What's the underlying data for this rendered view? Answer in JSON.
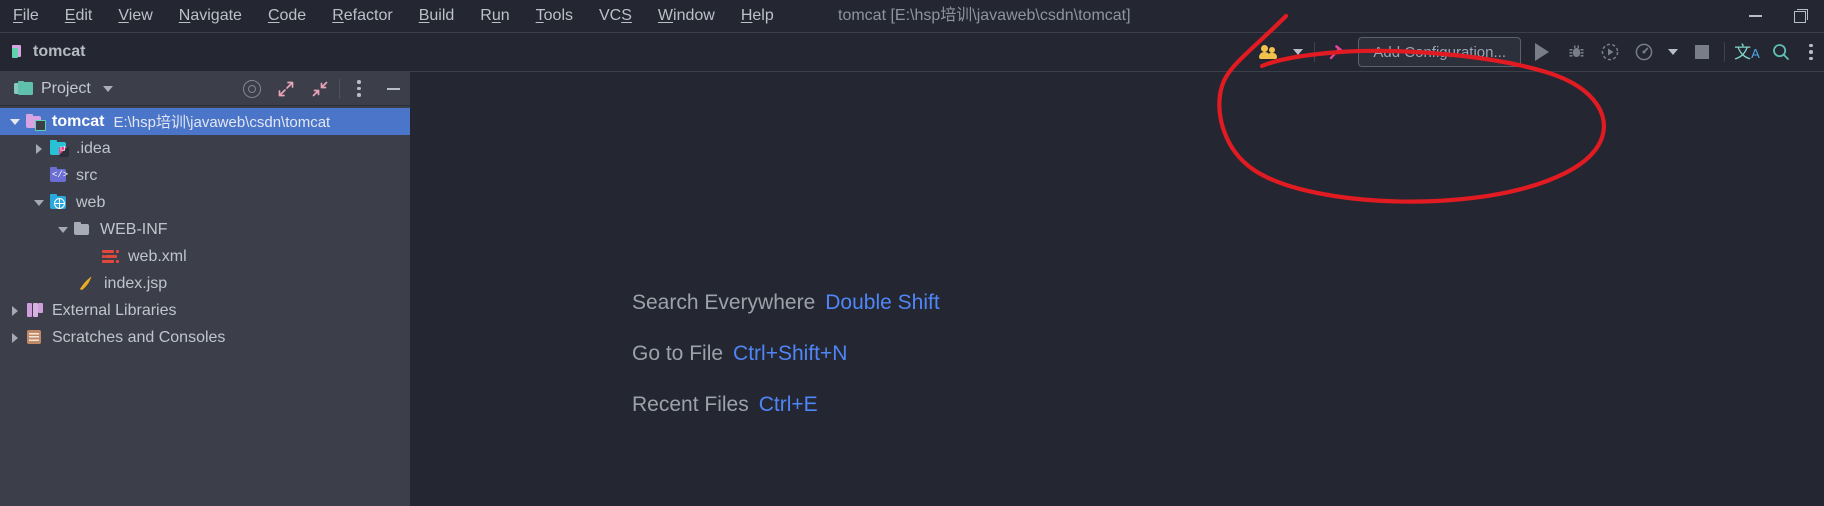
{
  "window": {
    "title": "tomcat [E:\\hsp培训\\javaweb\\csdn\\tomcat]",
    "minimize_label": "—",
    "restore_label": "❐",
    "colors": {
      "background": "#242731",
      "sidebar": "#3c3f4a",
      "selection": "#4b75c9",
      "accent_link": "#4f86f7",
      "annotation": "#e21b22"
    }
  },
  "menubar": {
    "items": [
      {
        "label": "File",
        "mnemonic": "F",
        "rest": "ile"
      },
      {
        "label": "Edit",
        "mnemonic": "E",
        "rest": "dit"
      },
      {
        "label": "View",
        "mnemonic": "V",
        "rest": "iew"
      },
      {
        "label": "Navigate",
        "mnemonic": "N",
        "rest": "avigate"
      },
      {
        "label": "Code",
        "mnemonic": "C",
        "rest": "ode"
      },
      {
        "label": "Refactor",
        "mnemonic": "R",
        "rest": "efactor"
      },
      {
        "label": "Build",
        "mnemonic": "B",
        "rest": "uild"
      },
      {
        "label": "Run",
        "mnemonic": "R",
        "rest": "un"
      },
      {
        "label": "Tools",
        "mnemonic": "T",
        "rest": "ools"
      },
      {
        "label": "VCS",
        "mnemonic": "S",
        "rest": "VC",
        "mnemonic_last": true
      },
      {
        "label": "Window",
        "mnemonic": "W",
        "rest": "indow"
      },
      {
        "label": "Help",
        "mnemonic": "H",
        "rest": "elp"
      }
    ]
  },
  "toolbar": {
    "breadcrumb": "tomcat",
    "breadcrumb_icon": "module-icon",
    "people_icon": "people-icon",
    "people_caret_icon": "chevron-down-icon",
    "build_icon": "hammer-icon",
    "add_configuration_label": "Add Configuration...",
    "run_icon": "run-play-icon",
    "debug_icon": "debug-bug-icon",
    "run_coverage_icon": "run-with-coverage-icon",
    "profiler_icon": "profiler-gauge-icon",
    "profiler_caret_icon": "chevron-down-icon",
    "stop_icon": "stop-square-icon",
    "translate_icon": "translate-icon",
    "translate_glyph": "文",
    "translate_sub": "A",
    "search_icon": "search-icon",
    "more_icon": "more-vertical-icon"
  },
  "sidebar": {
    "panel_title": "Project",
    "panel_icon": "project-folder-icon",
    "panel_chevron_icon": "chevron-down-icon",
    "actions": {
      "select_opened_file_icon": "target-icon",
      "expand_all_icon": "expand-arrows-icon",
      "collapse_all_icon": "collapse-arrows-icon",
      "options_icon": "more-vertical-icon",
      "hide_icon": "minimize-panel-icon"
    },
    "tree": [
      {
        "label": "tomcat",
        "path": "E:\\hsp培训\\javaweb\\csdn\\tomcat",
        "icon": "project-module-folder-icon",
        "indent": 0,
        "twisty": "down",
        "selected": true
      },
      {
        "label": ".idea",
        "path": "",
        "icon": "idea-folder-icon",
        "indent": 1,
        "twisty": "right",
        "selected": false
      },
      {
        "label": "src",
        "path": "",
        "icon": "source-folder-icon",
        "indent": 1,
        "twisty": "none",
        "selected": false
      },
      {
        "label": "web",
        "path": "",
        "icon": "web-folder-icon",
        "indent": 1,
        "twisty": "down",
        "selected": false
      },
      {
        "label": "WEB-INF",
        "path": "",
        "icon": "plain-folder-icon",
        "indent": 2,
        "twisty": "down",
        "selected": false
      },
      {
        "label": "web.xml",
        "path": "",
        "icon": "xml-file-icon",
        "indent": 3,
        "twisty": "none",
        "selected": false
      },
      {
        "label": "index.jsp",
        "path": "",
        "icon": "jsp-file-icon",
        "indent": 2,
        "twisty": "none",
        "selected": false
      },
      {
        "label": "External Libraries",
        "path": "",
        "icon": "external-libraries-icon",
        "indent": 0,
        "twisty": "right",
        "selected": false
      },
      {
        "label": "Scratches and Consoles",
        "path": "",
        "icon": "scratches-icon",
        "indent": 0,
        "twisty": "right",
        "selected": false
      }
    ]
  },
  "editor": {
    "hints": [
      {
        "label": "Search Everywhere",
        "key": "Double Shift"
      },
      {
        "label": "Go to File",
        "key": "Ctrl+Shift+N"
      },
      {
        "label": "Recent Files",
        "key": "Ctrl+E"
      }
    ]
  },
  "annotation": {
    "shape": "hand-drawn-red-ellipse",
    "target": "Add Configuration... button",
    "color": "#e21b22"
  }
}
